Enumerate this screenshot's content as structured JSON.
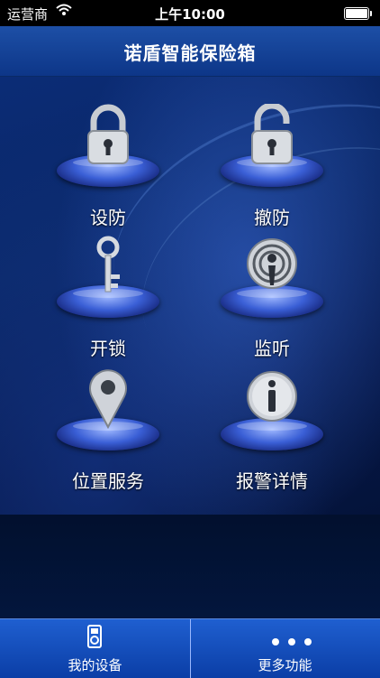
{
  "status_bar": {
    "carrier": "运营商",
    "time": "上午10:00"
  },
  "nav": {
    "title": "诺盾智能保险箱"
  },
  "grid": {
    "items": [
      {
        "label": "设防",
        "icon": "lock-closed-icon"
      },
      {
        "label": "撤防",
        "icon": "lock-open-icon"
      },
      {
        "label": "开锁",
        "icon": "key-icon"
      },
      {
        "label": "监听",
        "icon": "listen-icon"
      },
      {
        "label": "位置服务",
        "icon": "location-pin-icon"
      },
      {
        "label": "报警详情",
        "icon": "info-icon"
      }
    ]
  },
  "tabbar": {
    "items": [
      {
        "label": "我的设备",
        "icon": "device-icon"
      },
      {
        "label": "更多功能",
        "icon": "more-dots-icon"
      }
    ]
  },
  "colors": {
    "nav": "#1d4fa6",
    "tabbar": "#1f5fd0",
    "disc": "#3a5fd6"
  }
}
